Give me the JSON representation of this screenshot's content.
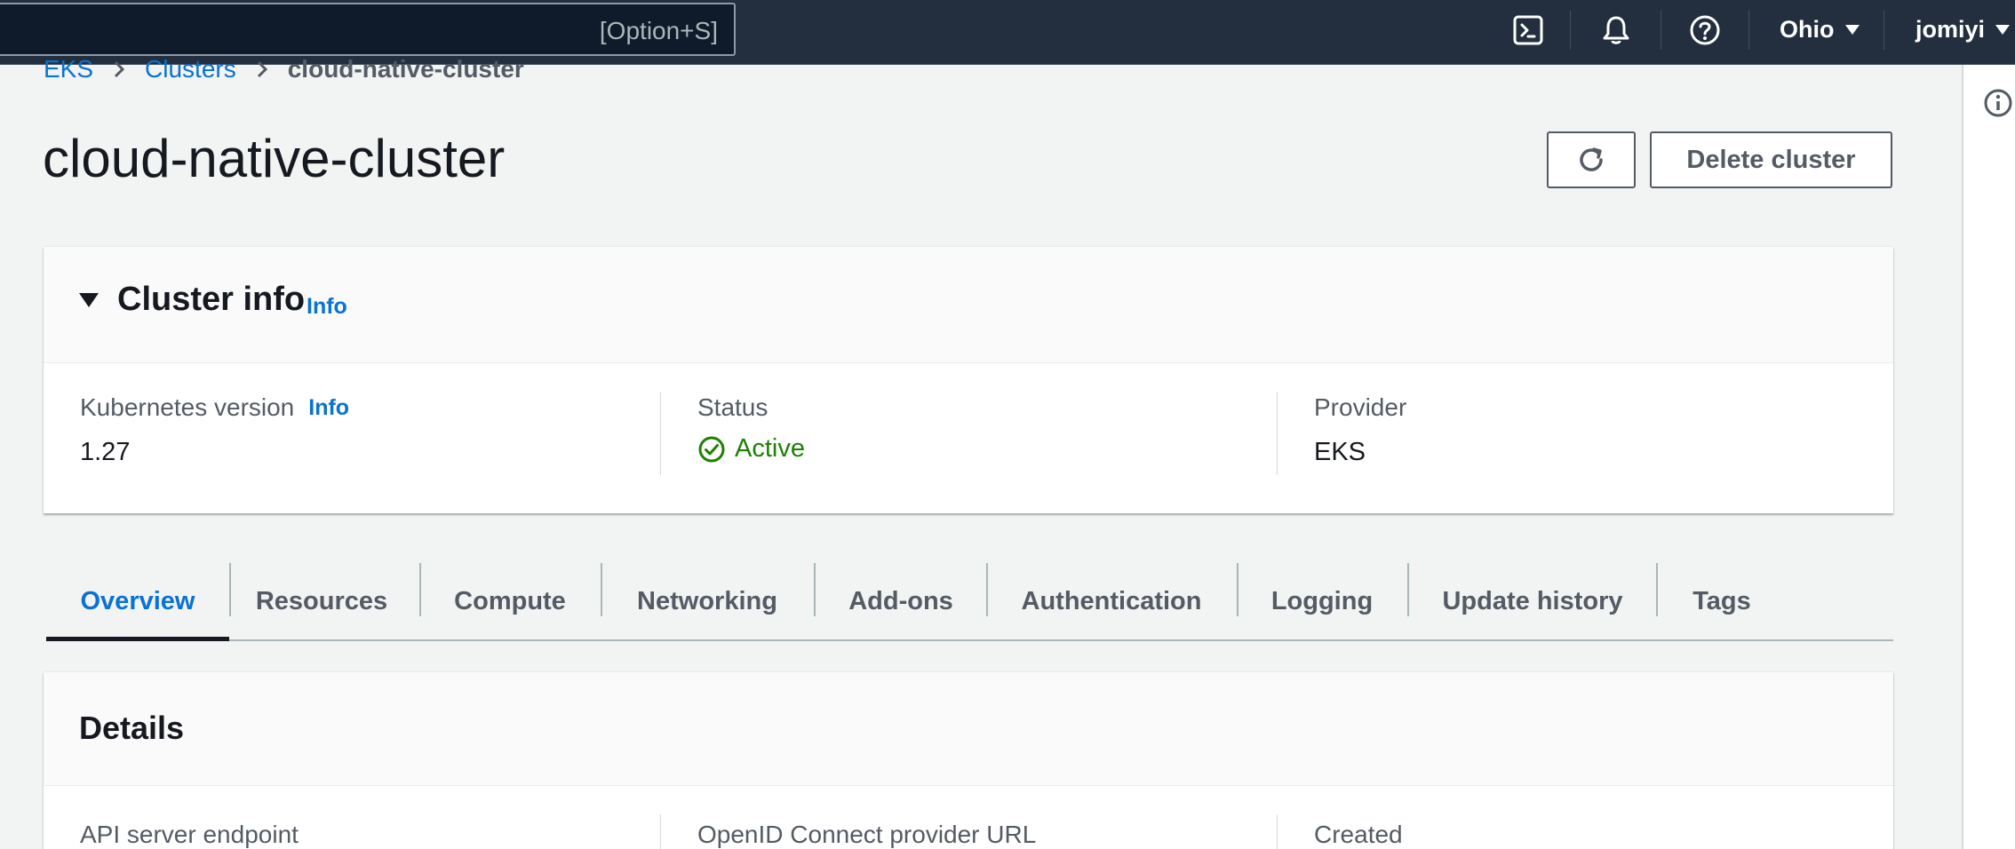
{
  "topbar": {
    "search_shortcut": "[Option+S]",
    "region": "Ohio",
    "user": "jomiyi"
  },
  "breadcrumb": {
    "items": [
      "EKS",
      "Clusters"
    ],
    "current": "cloud-native-cluster"
  },
  "page": {
    "title": "cloud-native-cluster",
    "delete_label": "Delete cluster"
  },
  "cluster_info": {
    "title": "Cluster info",
    "info_label": "Info",
    "kubernetes_version_label": "Kubernetes version",
    "kubernetes_version_info": "Info",
    "kubernetes_version": "1.27",
    "status_label": "Status",
    "status": "Active",
    "provider_label": "Provider",
    "provider": "EKS"
  },
  "tabs": [
    "Overview",
    "Resources",
    "Compute",
    "Networking",
    "Add-ons",
    "Authentication",
    "Logging",
    "Update history",
    "Tags"
  ],
  "details": {
    "title": "Details",
    "api_endpoint_label": "API server endpoint",
    "oidc_label": "OpenID Connect provider URL",
    "created_label": "Created"
  },
  "colors": {
    "nav_bg": "#232f3e",
    "link": "#0972d3",
    "success": "#1d8102",
    "page_bg": "#f2f3f3"
  }
}
